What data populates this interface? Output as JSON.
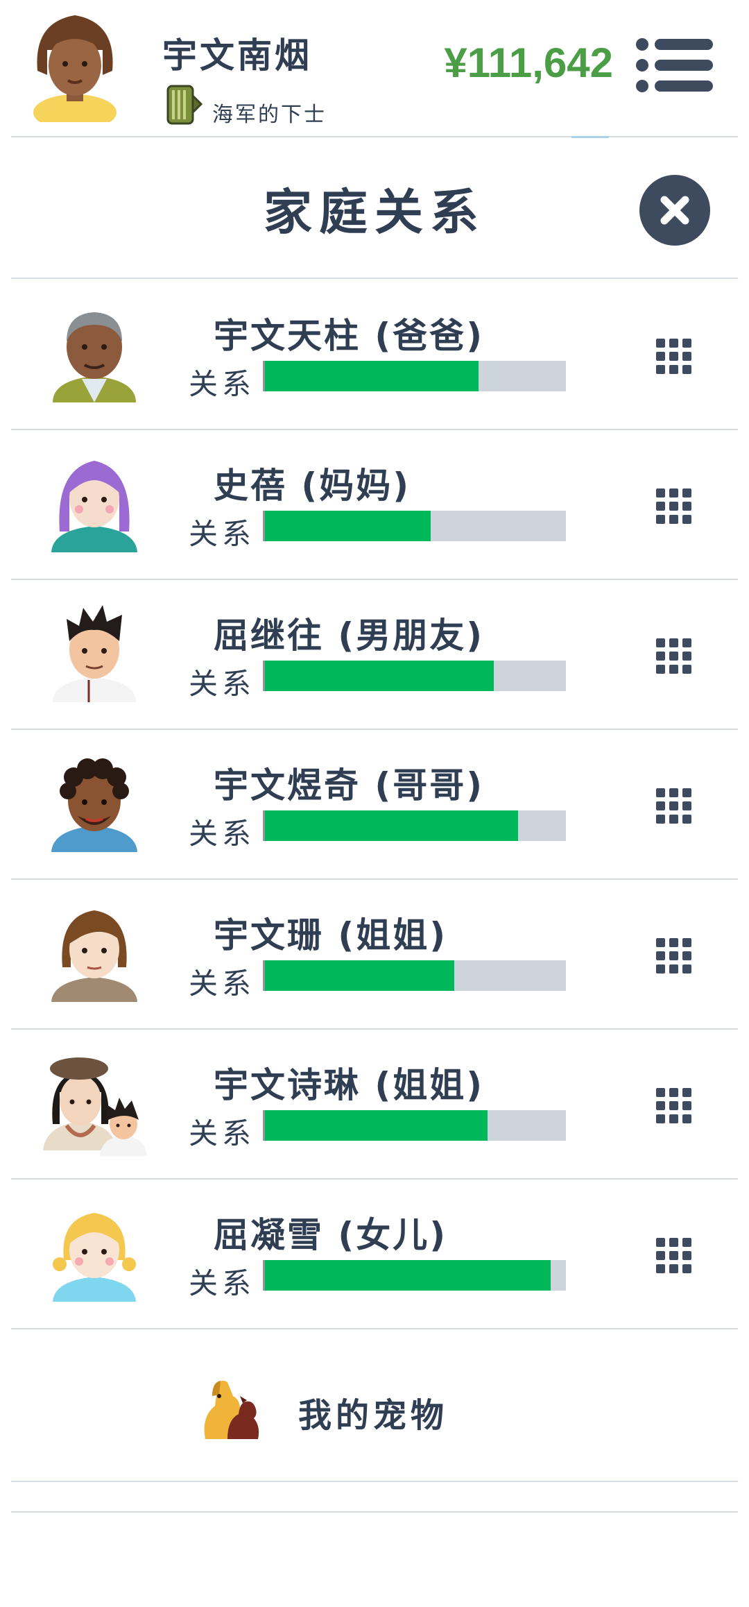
{
  "header": {
    "player_name": "宇文南烟",
    "rank": "海军的下士",
    "money": "¥111,642"
  },
  "modal": {
    "title": "家庭关系"
  },
  "relation_label": "关系",
  "members": [
    {
      "name": "宇文天柱 (爸爸)",
      "relationship": 0.71,
      "avatar": "old-man-avatar"
    },
    {
      "name": "史蓓 (妈妈)",
      "relationship": 0.55,
      "avatar": "purple-hair-woman-avatar"
    },
    {
      "name": "屈继往 (男朋友)",
      "relationship": 0.76,
      "avatar": "spiky-hair-man-avatar"
    },
    {
      "name": "宇文煜奇 (哥哥)",
      "relationship": 0.84,
      "avatar": "curly-hair-man-avatar"
    },
    {
      "name": "宇文珊 (姐姐)",
      "relationship": 0.63,
      "avatar": "brown-hair-woman-avatar"
    },
    {
      "name": "宇文诗琳 (姐姐)",
      "relationship": 0.74,
      "avatar": "woman-with-child-avatar"
    },
    {
      "name": "屈凝雪 (女儿)",
      "relationship": 0.95,
      "avatar": "blonde-girl-avatar"
    }
  ],
  "pets": {
    "label": "我的宠物",
    "icon": "dog-icon"
  },
  "colors": {
    "money": "#4b9e45",
    "bar_fill": "#00b85a",
    "bar_track": "#cdd4dc",
    "text": "#2f3e52",
    "close_button": "#3e4a5d"
  }
}
